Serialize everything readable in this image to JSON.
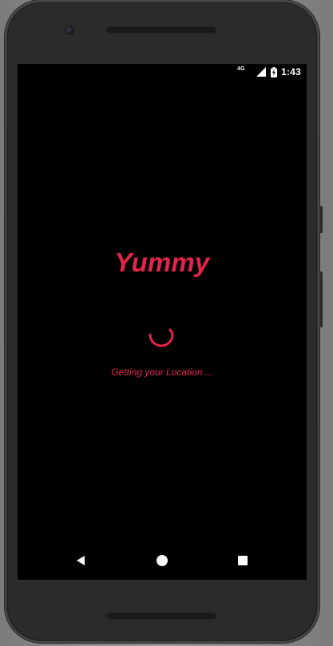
{
  "status_bar": {
    "network_type": "4G",
    "signal_icon": "signal-icon",
    "battery_icon": "battery-charging-icon",
    "time": "1:43"
  },
  "app": {
    "title": "Yummy",
    "loading_message": "Getting your Location ...",
    "accent_color": "#e6234a"
  },
  "nav_bar": {
    "back_icon": "back-triangle-icon",
    "home_icon": "home-circle-icon",
    "recents_icon": "recents-square-icon"
  }
}
